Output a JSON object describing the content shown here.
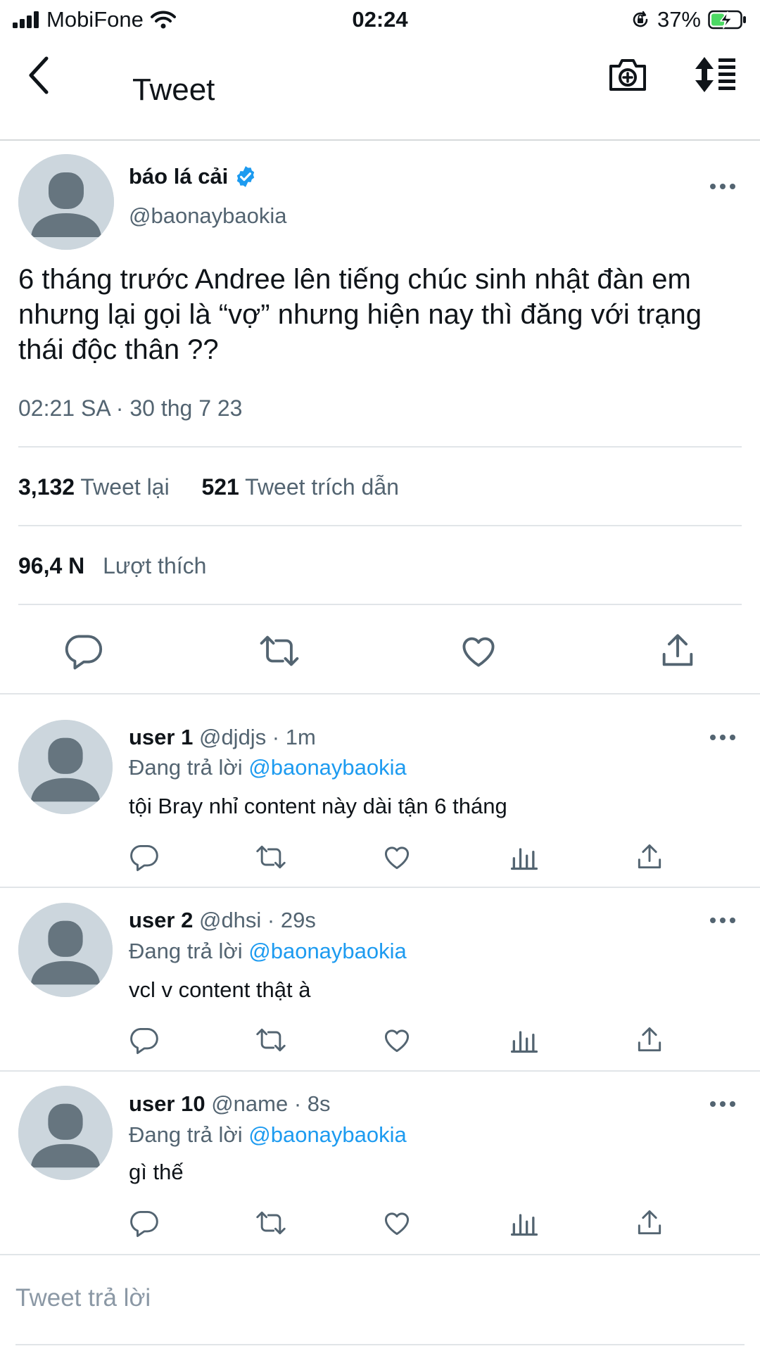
{
  "status_bar": {
    "carrier": "MobiFone",
    "time": "02:24",
    "battery": "37%"
  },
  "nav": {
    "title": "Tweet"
  },
  "tweet": {
    "author_name": "báo lá cải",
    "author_handle": "@baonaybaokia",
    "text": "6 tháng trước Andree lên tiếng chúc sinh nhật đàn em nhưng lại gọi là “vợ” nhưng hiện nay thì đăng với trạng thái độc thân ??",
    "timestamp": "02:21 SA · 30 thg 7 23",
    "retweets_count": "3,132",
    "retweets_label": "Tweet lại",
    "quotes_count": "521",
    "quotes_label": "Tweet trích dẫn",
    "likes_count": "96,4 N",
    "likes_label": "Lượt thích"
  },
  "replies": [
    {
      "name": "user 1",
      "handle": "@djdjs · 1m",
      "replying_label": "Đang trả lời",
      "mention": "@baonaybaokia",
      "text": "tội Bray nhỉ content này dài tận 6 tháng"
    },
    {
      "name": "user 2",
      "handle": "@dhsi · 29s",
      "replying_label": "Đang trả lời",
      "mention": "@baonaybaokia",
      "text": "vcl v content thật à"
    },
    {
      "name": "user 10",
      "handle": "@name · 8s",
      "replying_label": "Đang trả lời",
      "mention": "@baonaybaokia",
      "text": "gì thế"
    }
  ],
  "compose": {
    "placeholder": "Tweet trả lời"
  },
  "colors": {
    "accent": "#1d9bf0",
    "secondary_text": "#536471",
    "avatar_bg": "#ccd6dd"
  },
  "icons": [
    "cellular-signal-icon",
    "wifi-icon",
    "orientation-lock-icon",
    "battery-charging-icon",
    "back-arrow-icon",
    "camera-add-icon",
    "sort-icon",
    "verified-badge-icon",
    "more-icon",
    "reply-icon",
    "retweet-icon",
    "like-icon",
    "share-icon",
    "analytics-icon"
  ]
}
